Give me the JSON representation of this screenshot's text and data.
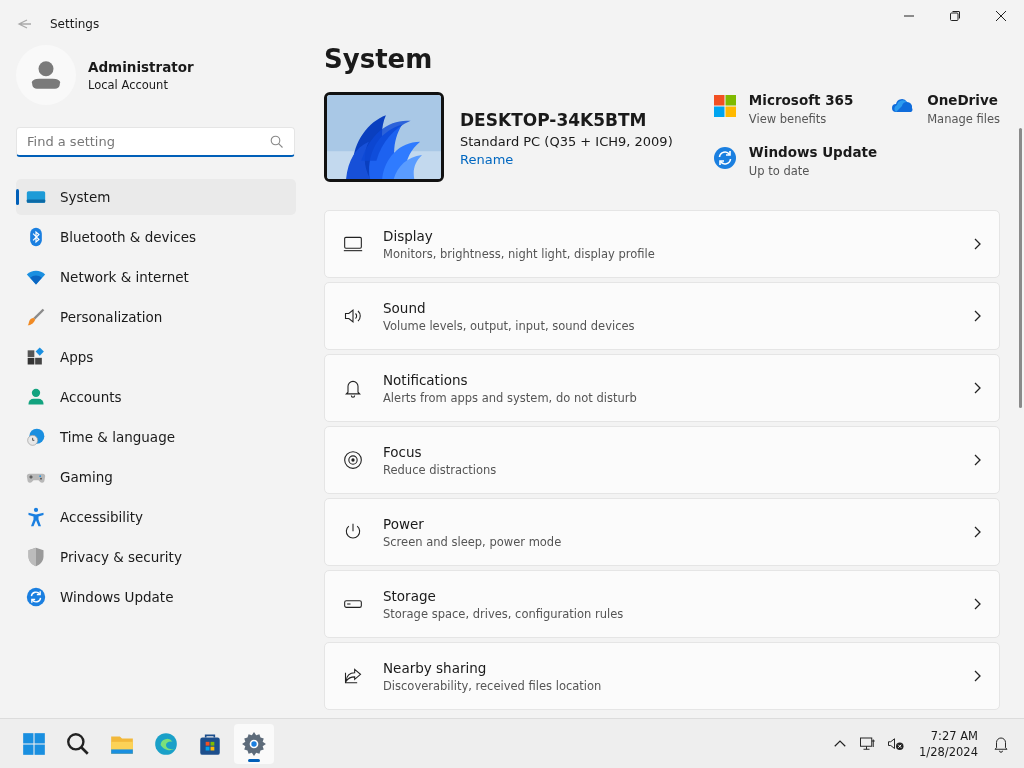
{
  "window": {
    "title": "Settings"
  },
  "profile": {
    "name": "Administrator",
    "account": "Local Account"
  },
  "search": {
    "placeholder": "Find a setting"
  },
  "sidebar": {
    "items": [
      {
        "label": "System",
        "selected": true
      },
      {
        "label": "Bluetooth & devices",
        "selected": false
      },
      {
        "label": "Network & internet",
        "selected": false
      },
      {
        "label": "Personalization",
        "selected": false
      },
      {
        "label": "Apps",
        "selected": false
      },
      {
        "label": "Accounts",
        "selected": false
      },
      {
        "label": "Time & language",
        "selected": false
      },
      {
        "label": "Gaming",
        "selected": false
      },
      {
        "label": "Accessibility",
        "selected": false
      },
      {
        "label": "Privacy & security",
        "selected": false
      },
      {
        "label": "Windows Update",
        "selected": false
      }
    ]
  },
  "page": {
    "title": "System"
  },
  "device": {
    "name": "DESKTOP-34K5BTM",
    "model": "Standard PC (Q35 + ICH9, 2009)",
    "rename_link": "Rename"
  },
  "quick_links": [
    {
      "title": "Microsoft 365",
      "subtitle": "View benefits"
    },
    {
      "title": "OneDrive",
      "subtitle": "Manage files"
    },
    {
      "title": "Windows Update",
      "subtitle": "Up to date"
    }
  ],
  "settings": [
    {
      "title": "Display",
      "subtitle": "Monitors, brightness, night light, display profile"
    },
    {
      "title": "Sound",
      "subtitle": "Volume levels, output, input, sound devices"
    },
    {
      "title": "Notifications",
      "subtitle": "Alerts from apps and system, do not disturb"
    },
    {
      "title": "Focus",
      "subtitle": "Reduce distractions"
    },
    {
      "title": "Power",
      "subtitle": "Screen and sleep, power mode"
    },
    {
      "title": "Storage",
      "subtitle": "Storage space, drives, configuration rules"
    },
    {
      "title": "Nearby sharing",
      "subtitle": "Discoverability, received files location"
    }
  ],
  "taskbar": {
    "apps": [
      {
        "running": false
      },
      {
        "running": false
      },
      {
        "running": false
      },
      {
        "running": false
      },
      {
        "running": false
      },
      {
        "running": true
      }
    ],
    "time": "7:27 AM",
    "date": "1/28/2024"
  }
}
